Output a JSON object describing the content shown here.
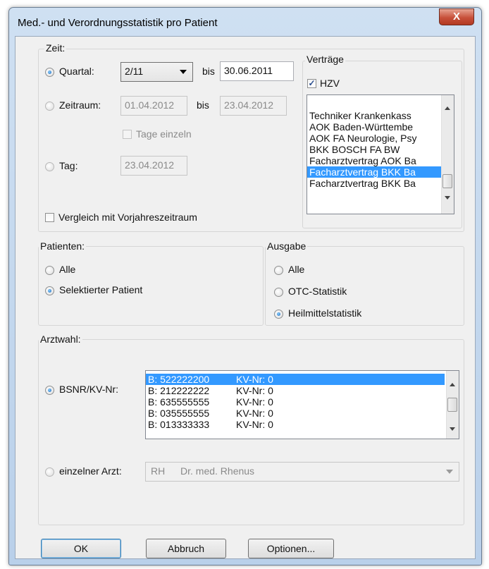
{
  "window": {
    "title": "Med.- und Verordnungsstatistik pro Patient",
    "close_glyph": "X"
  },
  "zeit": {
    "legend": "Zeit:",
    "quartal": {
      "label": "Quartal:",
      "selected": true,
      "value": "2/11",
      "bis": "bis",
      "bis_value": "30.06.2011"
    },
    "zeitraum": {
      "label": "Zeitraum:",
      "selected": false,
      "from": "01.04.2012",
      "bis": "bis",
      "to": "23.04.2012"
    },
    "tage_einzeln": {
      "label": "Tage einzeln",
      "checked": false
    },
    "tag": {
      "label": "Tag:",
      "selected": false,
      "value": "23.04.2012"
    },
    "vergleich": {
      "label": "Vergleich mit Vorjahreszeitraum",
      "checked": false
    }
  },
  "vertraege": {
    "legend": "Verträge",
    "hzv": {
      "label": "HZV",
      "checked": true,
      "check_glyph": "✓"
    },
    "items": [
      "Techniker Krankenkass",
      "AOK Baden-Württembe",
      "AOK FA Neurologie, Psy",
      "BKK BOSCH FA BW",
      "Facharztvertrag AOK Ba",
      "Facharztvertrag BKK Ba",
      "Facharztvertrag BKK Ba"
    ],
    "selected_index": 5
  },
  "patienten": {
    "legend": "Patienten:",
    "options": [
      {
        "label": "Alle",
        "selected": false
      },
      {
        "label": "Selektierter Patient",
        "selected": true
      }
    ]
  },
  "ausgabe": {
    "legend": "Ausgabe",
    "options": [
      {
        "label": "Alle",
        "selected": false
      },
      {
        "label": "OTC-Statistik",
        "selected": false
      },
      {
        "label": "Heilmittelstatistik",
        "selected": true
      }
    ]
  },
  "arztwahl": {
    "legend": "Arztwahl:",
    "bsnr": {
      "label": "BSNR/KV-Nr:",
      "selected": true,
      "rows": [
        {
          "bsnr": "B: 522222200",
          "kv": "KV-Nr: 0"
        },
        {
          "bsnr": "B: 212222222",
          "kv": "KV-Nr: 0"
        },
        {
          "bsnr": "B: 635555555",
          "kv": "KV-Nr: 0"
        },
        {
          "bsnr": "B: 035555555",
          "kv": "KV-Nr: 0"
        },
        {
          "bsnr": "B: 013333333",
          "kv": "KV-Nr: 0"
        }
      ],
      "selected_index": 0
    },
    "einzelner": {
      "label": "einzelner Arzt:",
      "selected": false,
      "code": "RH",
      "name": "Dr. med. Rhenus"
    }
  },
  "buttons": {
    "ok": "OK",
    "abbruch": "Abbruch",
    "optionen": "Optionen..."
  }
}
